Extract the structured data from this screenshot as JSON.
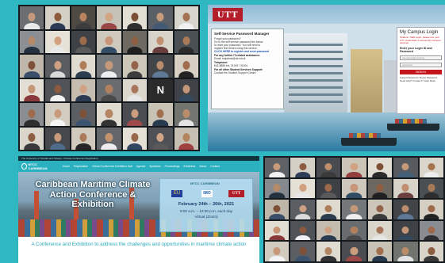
{
  "video_grid_top": {
    "tiles": [
      {
        "kind": "person",
        "bg": "#6b6e70",
        "skin": "#c59a7c",
        "shirt": "#e9e9e9"
      },
      {
        "kind": "person",
        "bg": "#d4d0c6",
        "skin": "#8c5b3d",
        "shirt": "#2b3a55"
      },
      {
        "kind": "person",
        "bg": "#4d4a44",
        "skin": "#b98560",
        "shirt": "#3c3c3c"
      },
      {
        "kind": "person",
        "bg": "#c7c2b8",
        "skin": "#d2a585",
        "shirt": "#9a4646"
      },
      {
        "kind": "person",
        "bg": "#e2ded4",
        "skin": "#7a4f36",
        "shirt": "#2f2f2f"
      },
      {
        "kind": "person",
        "bg": "#5a6066",
        "skin": "#c79c7b",
        "shirt": "#445a74"
      },
      {
        "kind": "person",
        "bg": "#d8d5cc",
        "skin": "#a47250",
        "shirt": "#f0f0f0"
      },
      {
        "kind": "person",
        "bg": "#8b8f93",
        "skin": "#b68a69",
        "shirt": "#22303f"
      },
      {
        "kind": "person",
        "bg": "#e6e2d8",
        "skin": "#d1a080",
        "shirt": "#e8e8e8"
      },
      {
        "kind": "person",
        "bg": "#3e4246",
        "skin": "#9c6a4c",
        "shirt": "#5b5b5b"
      },
      {
        "kind": "person",
        "bg": "#cfc9bd",
        "skin": "#c8967a",
        "shirt": "#334d66"
      },
      {
        "kind": "person",
        "bg": "#6e6a62",
        "skin": "#8f5f43",
        "shirt": "#1f1f1f"
      },
      {
        "kind": "person",
        "bg": "#d9d4c9",
        "skin": "#c09070",
        "shirt": "#6a3d3d"
      },
      {
        "kind": "person",
        "bg": "#4b5055",
        "skin": "#a97a58",
        "shirt": "#2b2b2b"
      },
      {
        "kind": "person",
        "bg": "#bfb8aa",
        "skin": "#7e5038",
        "shirt": "#3c4f6a"
      },
      {
        "kind": "person",
        "bg": "#595c60",
        "skin": "#cda084",
        "shirt": "#d9d9d9"
      },
      {
        "kind": "person",
        "bg": "#e0dbd0",
        "skin": "#b07d5b",
        "shirt": "#2c3e50"
      },
      {
        "kind": "person",
        "bg": "#76797c",
        "skin": "#c4987a",
        "shirt": "#efefef"
      },
      {
        "kind": "person",
        "bg": "#cdc7ba",
        "skin": "#94634a",
        "shirt": "#3d3d3d"
      },
      {
        "kind": "person",
        "bg": "#434649",
        "skin": "#b88c6c",
        "shirt": "#5e7a96"
      },
      {
        "kind": "person",
        "bg": "#d6d0c4",
        "skin": "#a06c4e",
        "shirt": "#222222"
      },
      {
        "kind": "person",
        "bg": "#e3dfd5",
        "skin": "#c69676",
        "shirt": "#8a3a3a"
      },
      {
        "kind": "person",
        "bg": "#505357",
        "skin": "#8b5a40",
        "shirt": "#f2f2f2"
      },
      {
        "kind": "person",
        "bg": "#c4bdb0",
        "skin": "#d0a283",
        "shirt": "#2a3b52"
      },
      {
        "kind": "person",
        "bg": "#6a6d70",
        "skin": "#b1805f",
        "shirt": "#4a4a4a"
      },
      {
        "kind": "person",
        "bg": "#dcd7cc",
        "skin": "#a7755a",
        "shirt": "#e6e6e6"
      },
      {
        "kind": "letter",
        "bg": "#2b2b2b",
        "letter": "N"
      },
      {
        "kind": "person",
        "bg": "#3f4246",
        "skin": "#c3967a",
        "shirt": "#34495e"
      },
      {
        "kind": "person",
        "bg": "#8a8e92",
        "skin": "#9e6b4d",
        "shirt": "#2e2e2e"
      },
      {
        "kind": "person",
        "bg": "#d3cdc1",
        "skin": "#c9997b",
        "shirt": "#f4f4f4"
      },
      {
        "kind": "person",
        "bg": "#5c5f63",
        "skin": "#7f5139",
        "shirt": "#3b5570"
      },
      {
        "kind": "person",
        "bg": "#e1dcd1",
        "skin": "#b58664",
        "shirt": "#333333"
      },
      {
        "kind": "person",
        "bg": "#4a4d51",
        "skin": "#cc9e80",
        "shirt": "#9c4a4a"
      },
      {
        "kind": "person",
        "bg": "#c9c3b6",
        "skin": "#a26f51",
        "shirt": "#283a4f"
      },
      {
        "kind": "person",
        "bg": "#72756f",
        "skin": "#bb8d6b",
        "shirt": "#e4e4e4"
      },
      {
        "kind": "person",
        "bg": "#dad5ca",
        "skin": "#8e5e44",
        "shirt": "#3a3a3a"
      },
      {
        "kind": "person",
        "bg": "#45484c",
        "skin": "#c89a7d",
        "shirt": "#4f6d8a"
      },
      {
        "kind": "person",
        "bg": "#d0cabe",
        "skin": "#ab7a5a",
        "shirt": "#262626"
      },
      {
        "kind": "person",
        "bg": "#63666a",
        "skin": "#c0926f",
        "shirt": "#ededed"
      },
      {
        "kind": "person",
        "bg": "#e4e0d6",
        "skin": "#98664a",
        "shirt": "#2f4560"
      },
      {
        "kind": "person",
        "bg": "#4e5155",
        "skin": "#d3a587",
        "shirt": "#5a5a5a"
      },
      {
        "kind": "person",
        "bg": "#c6c0b3",
        "skin": "#b4845f",
        "shirt": "#a04040"
      }
    ]
  },
  "utt_campus": {
    "logo": "UTT",
    "password_manager": {
      "title": "Self-Service Password Manager",
      "lines": [
        "Forgot your password?",
        "Go to the self service password link below",
        "to reset your password. You will need to",
        "register first before using this service.",
        "CLICK HERE to register and reset password"
      ],
      "sections": [
        {
          "head": "For any further IT-related assistance:",
          "text": "Email: helpdesk@utt.edu.tt"
        },
        {
          "head": "Telephone:",
          "text": "642-8888 ext. 31003 / 31004"
        },
        {
          "head": "For all other Student Services Support:",
          "text": "Contact the Student Support Centre"
        }
      ]
    },
    "login": {
      "title": "My Campus Login",
      "notice": "Student / Staff Login, please use your UTT credentials to access My Campus services",
      "subtitle": "Enter your Login ID and Password",
      "username_placeholder": "username@utt.edu.tt",
      "password_placeholder": "password",
      "button": "SIGN IN",
      "help": "Forgot Password / Reset Password  Need help? Contact IT Help Desk"
    }
  },
  "conference_site": {
    "strip_text": "The University of Trinidad and Tobago  •  Climate Conference Registration",
    "nav_logo": "MTCC CARIBBEAN",
    "menu": [
      "Home",
      "Registration",
      "Virtual Conference Exhibition Hall",
      "Agenda",
      "Speakers",
      "Proceedings",
      "Exhibitors",
      "About",
      "Contact"
    ],
    "hero_title": "Caribbean Maritime Climate Action Conference & Exhibition",
    "card": {
      "logo_text": "MTCC CARIBBEAN",
      "dates": "February 24th – 26th, 2021",
      "time": "9:00 a.m. – 12:00 p.m. each day",
      "mode": "Virtual (Zoom)",
      "logos": [
        "EU",
        "IMO",
        "UTT"
      ]
    },
    "tagline": "A Conference and Exhibition to address the challenges and opportunities in maritime climate action"
  },
  "video_grid_bottom": {
    "tiles": [
      {
        "kind": "person",
        "bg": "#5e6266",
        "skin": "#c79a7b",
        "shirt": "#f1f1f1"
      },
      {
        "kind": "person",
        "bg": "#d5d0c5",
        "skin": "#8d5c40",
        "shirt": "#2e3e56"
      },
      {
        "kind": "person",
        "bg": "#484b4f",
        "skin": "#bf8f6e",
        "shirt": "#3a3a3a"
      },
      {
        "kind": "person",
        "bg": "#cbc5b8",
        "skin": "#d0a182",
        "shirt": "#963f3f"
      },
      {
        "kind": "person",
        "bg": "#e1ddd3",
        "skin": "#7c4e36",
        "shirt": "#2b2b2b"
      },
      {
        "kind": "person",
        "bg": "#575b60",
        "skin": "#c59a79",
        "shirt": "#446078"
      },
      {
        "kind": "person",
        "bg": "#d9d5cb",
        "skin": "#a5744f",
        "shirt": "#ededed"
      },
      {
        "kind": "person",
        "bg": "#868a8e",
        "skin": "#b58a68",
        "shirt": "#24323f"
      },
      {
        "kind": "person",
        "bg": "#e5e1d7",
        "skin": "#cf9f80",
        "shirt": "#e6e6e6"
      },
      {
        "kind": "person",
        "bg": "#3d4145",
        "skin": "#9b694b",
        "shirt": "#5a5a5a"
      },
      {
        "kind": "person",
        "bg": "#cec8bc",
        "skin": "#c7957a",
        "shirt": "#324b64"
      },
      {
        "kind": "person",
        "bg": "#6c6861",
        "skin": "#8e5e42",
        "shirt": "#202020"
      },
      {
        "kind": "person",
        "bg": "#d8d3c8",
        "skin": "#bf8f70",
        "shirt": "#6b3e3e"
      },
      {
        "kind": "person",
        "bg": "#4a4f54",
        "skin": "#a87957",
        "shirt": "#2d2d2d"
      },
      {
        "kind": "person",
        "bg": "#beb7a9",
        "skin": "#7d4f37",
        "shirt": "#3b4e69"
      },
      {
        "kind": "person",
        "bg": "#5b5e62",
        "skin": "#cc9f83",
        "shirt": "#dadada"
      },
      {
        "kind": "person",
        "bg": "#dfdacf",
        "skin": "#af7c5a",
        "shirt": "#2b3d4f"
      },
      {
        "kind": "person",
        "bg": "#75787b",
        "skin": "#c39779",
        "shirt": "#eeeeee"
      },
      {
        "kind": "person",
        "bg": "#ccc6b9",
        "skin": "#936249",
        "shirt": "#3c3c3c"
      },
      {
        "kind": "person",
        "bg": "#424548",
        "skin": "#b78b6b",
        "shirt": "#5d7995"
      },
      {
        "kind": "person",
        "bg": "#d5cfc3",
        "skin": "#9f6b4d",
        "shirt": "#232323"
      },
      {
        "kind": "person",
        "bg": "#e2ded4",
        "skin": "#c59575",
        "shirt": "#893939"
      },
      {
        "kind": "person",
        "bg": "#4f5256",
        "skin": "#8a593f",
        "shirt": "#f1f1f1"
      },
      {
        "kind": "person",
        "bg": "#c3bcaf",
        "skin": "#cfa182",
        "shirt": "#293a51"
      },
      {
        "kind": "person",
        "bg": "#696c6f",
        "skin": "#b07f5e",
        "shirt": "#494949"
      },
      {
        "kind": "person",
        "bg": "#dbd6cb",
        "skin": "#a67459",
        "shirt": "#e5e5e5"
      },
      {
        "kind": "person",
        "bg": "#3e4145",
        "skin": "#c29579",
        "shirt": "#33485d"
      },
      {
        "kind": "person",
        "bg": "#898d91",
        "skin": "#9d6a4c",
        "shirt": "#2d2d2d"
      },
      {
        "kind": "person",
        "bg": "#d2ccc0",
        "skin": "#c8987a",
        "shirt": "#f3f3f3"
      },
      {
        "kind": "person",
        "bg": "#5b5e62",
        "skin": "#7e5038",
        "shirt": "#3a546f"
      },
      {
        "kind": "person",
        "bg": "#e0dbd0",
        "skin": "#b48563",
        "shirt": "#323232"
      },
      {
        "kind": "person",
        "bg": "#494c50",
        "skin": "#cb9d7f",
        "shirt": "#9b4949"
      },
      {
        "kind": "person",
        "bg": "#c8c2b5",
        "skin": "#a16e50",
        "shirt": "#27394e"
      },
      {
        "kind": "person",
        "bg": "#71746e",
        "skin": "#ba8c6a",
        "shirt": "#e3e3e3"
      },
      {
        "kind": "person",
        "bg": "#d9d4c9",
        "skin": "#8d5d43",
        "shirt": "#393939"
      }
    ]
  }
}
